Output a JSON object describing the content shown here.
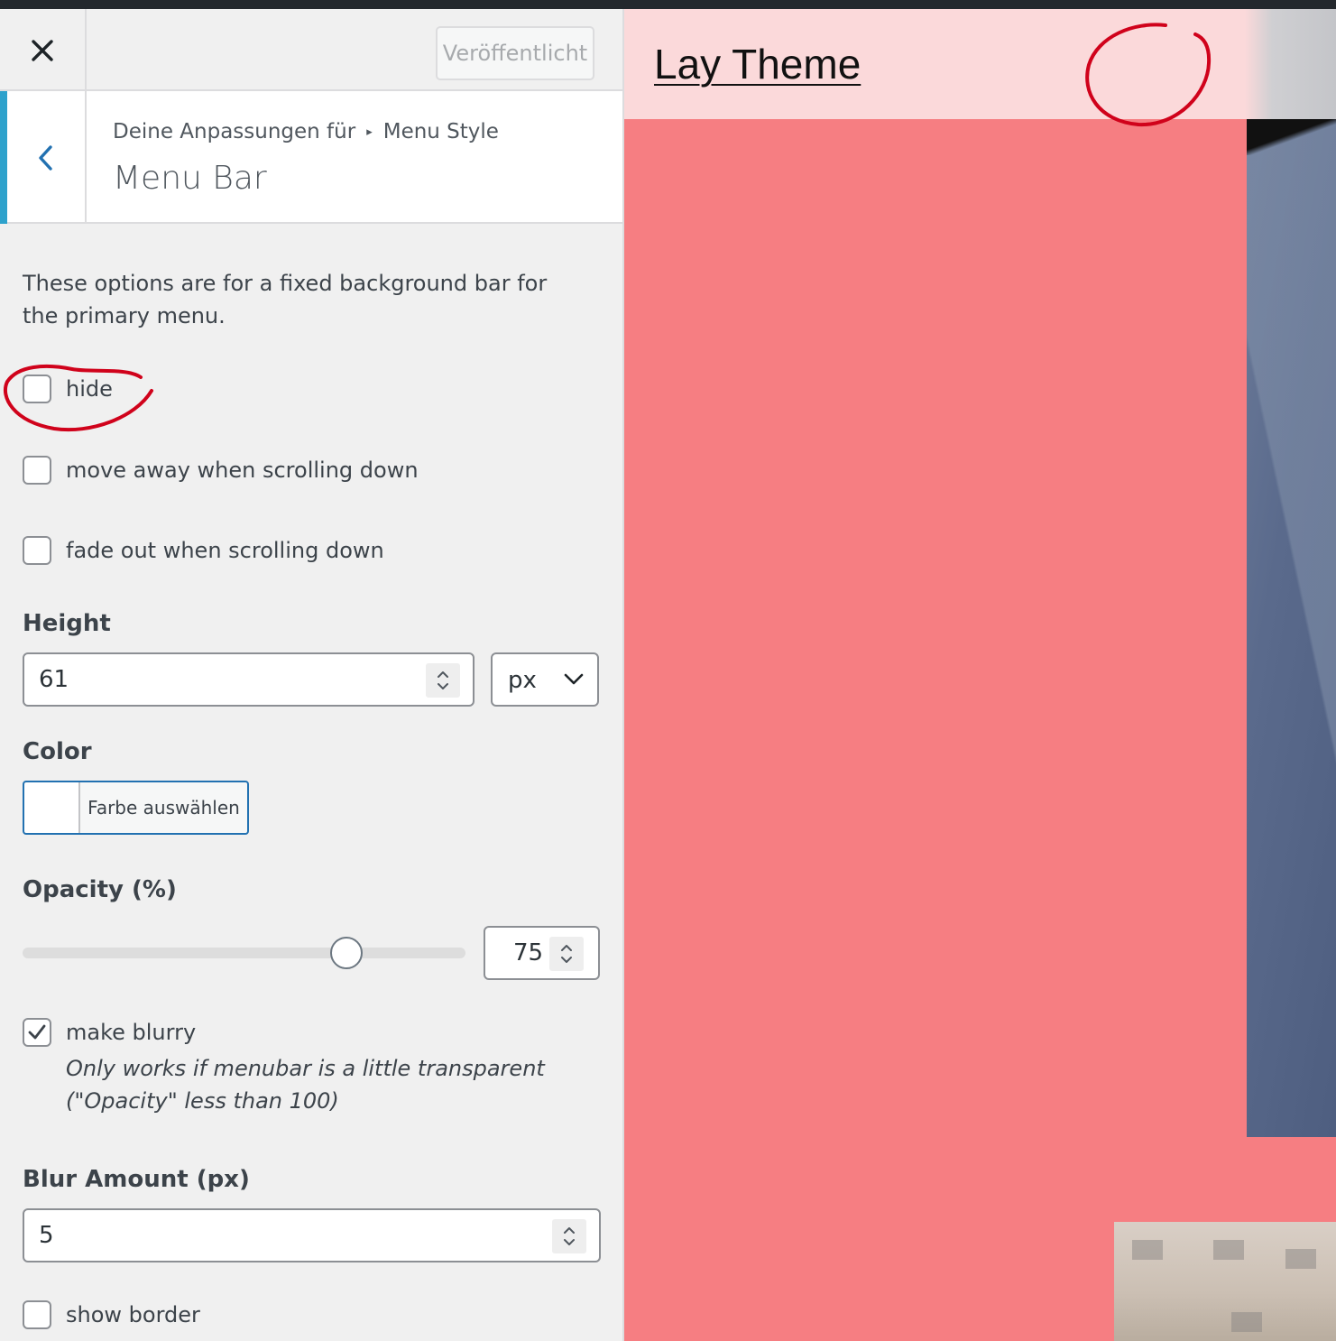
{
  "header": {
    "close_icon": "close-icon",
    "publish_label": "Veröffentlicht"
  },
  "section": {
    "back_icon": "chevron-left-icon",
    "breadcrumb_parent": "Deine Anpassungen für",
    "breadcrumb_separator": "▸",
    "breadcrumb_current": "Menu Style",
    "title": "Menu Bar"
  },
  "description": "These options are for a fixed background bar for the primary menu.",
  "options": {
    "hide": {
      "label": "hide",
      "checked": false
    },
    "move_away": {
      "label": "move away when scrolling down",
      "checked": false
    },
    "fade_out": {
      "label": "fade out when scrolling down",
      "checked": false
    },
    "make_blurry": {
      "label": "make blurry",
      "checked": true
    },
    "show_border": {
      "label": "show border",
      "checked": false
    }
  },
  "height": {
    "title": "Height",
    "value": "61",
    "unit": "px"
  },
  "color": {
    "title": "Color",
    "button_label": "Farbe auswählen",
    "value": "#ffffff"
  },
  "opacity": {
    "title": "Opacity (%)",
    "value": "75",
    "slider_fraction": 0.75
  },
  "blurry_hint": {
    "line1": "Only works if menubar is a little transparent",
    "line2": "(\"Opacity\" less than 100)"
  },
  "blur_amount": {
    "title": "Blur Amount (px)",
    "value": "5"
  },
  "preview": {
    "site_title": "Lay Theme",
    "background_color": "#f67e82",
    "menubar_color": "#fbd9da"
  },
  "colors": {
    "accent": "#2ea2cc",
    "focus": "#2271b1",
    "annotation": "#d0021b"
  }
}
